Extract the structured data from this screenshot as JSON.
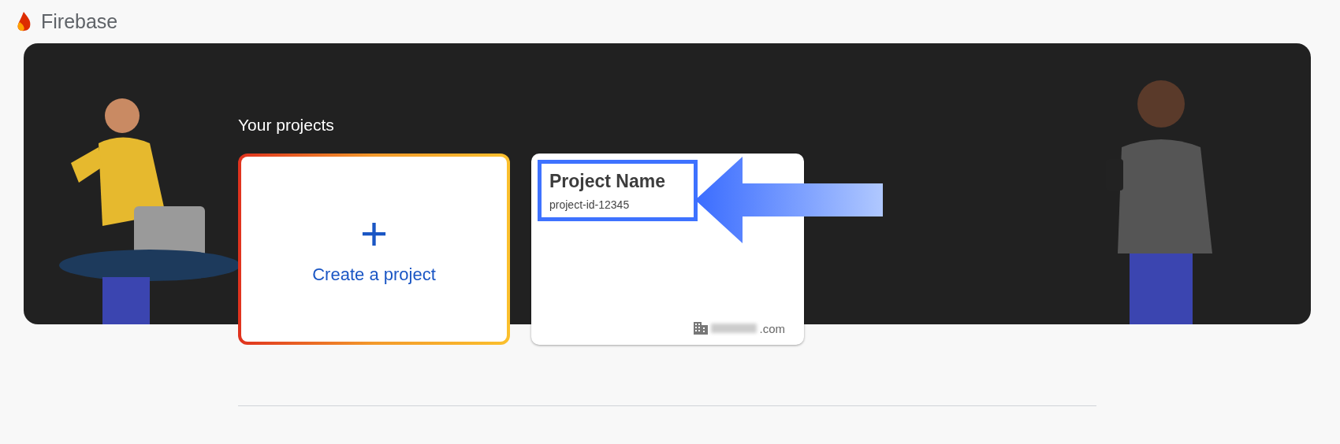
{
  "header": {
    "brand": "Firebase"
  },
  "banner": {
    "title": "Your projects"
  },
  "create_card": {
    "label": "Create a project",
    "icon": "+"
  },
  "projects": [
    {
      "name": "Project Name",
      "id": "project-id-12345",
      "domain_suffix": ".com",
      "highlighted": true
    }
  ]
}
